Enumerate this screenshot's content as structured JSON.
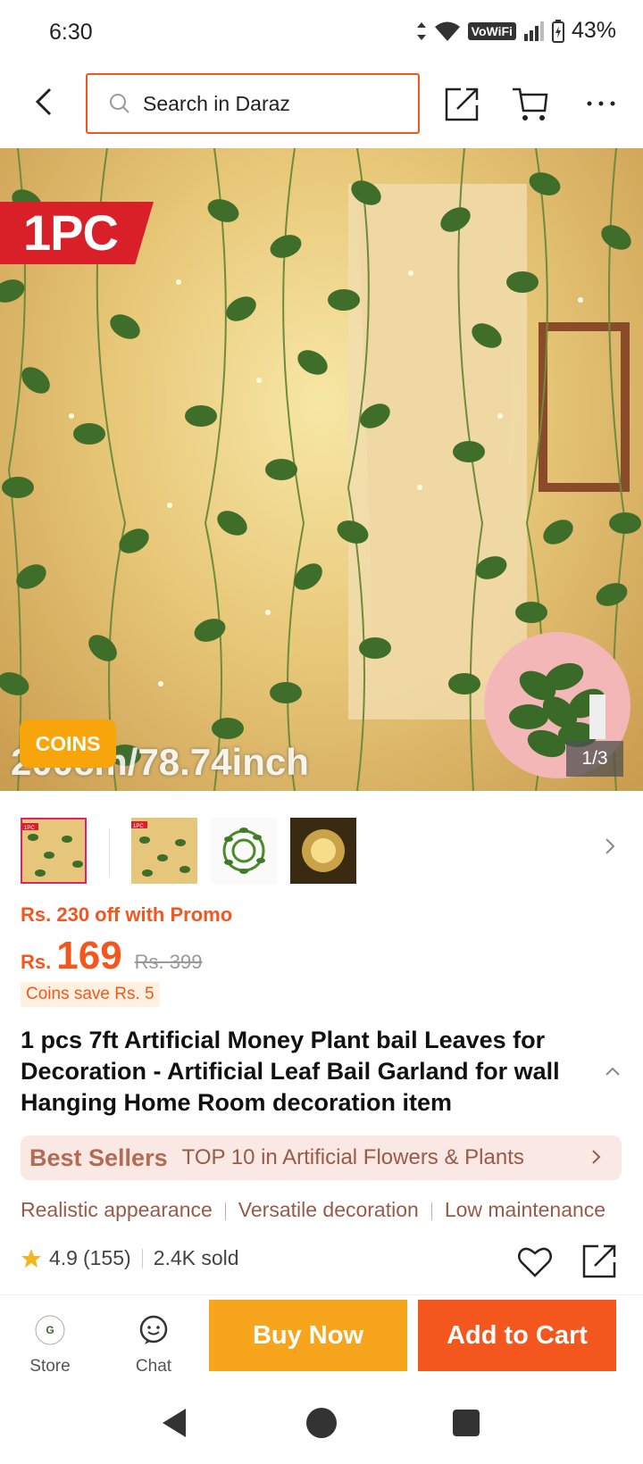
{
  "status_bar": {
    "time": "6:30",
    "network_badge": "VoWiFi",
    "battery": "43%"
  },
  "header": {
    "search_placeholder": "Search in Daraz",
    "icons": [
      "back-icon",
      "search-icon",
      "share-icon",
      "cart-icon",
      "more-icon"
    ]
  },
  "gallery": {
    "badge": "1PC",
    "coins_badge": "COINS",
    "overlay_text": "200cm/78.74inch",
    "counter": "1/3",
    "thumb_badge": "1PC",
    "thumbnails": [
      "thumb-1",
      "thumb-2",
      "thumb-3",
      "thumb-4"
    ]
  },
  "price": {
    "promo": "Rs. 230 off with Promo",
    "currency": "Rs.",
    "current": "169",
    "original": "Rs. 399",
    "coins_save": "Coins save Rs. 5"
  },
  "product": {
    "title": "1 pcs 7ft Artificial Money Plant bail Leaves for Decoration - Artificial Leaf Bail Garland for wall Hanging Home Room decoration item"
  },
  "best_sellers": {
    "logo": "Best Sellers",
    "text": "TOP 10 in Artificial Flowers & Plants"
  },
  "features": [
    "Realistic appearance",
    "Versatile decoration",
    "Low maintenance"
  ],
  "rating": {
    "score": "4.9",
    "count": "(155)",
    "sold": "2.4K sold"
  },
  "bottom_bar": {
    "store_label": "Store",
    "chat_label": "Chat",
    "buy_now": "Buy Now",
    "add_to_cart": "Add to Cart"
  },
  "colors": {
    "accent": "#f4571d",
    "buy_now": "#f7a51d",
    "coins": "#f7a50b"
  }
}
